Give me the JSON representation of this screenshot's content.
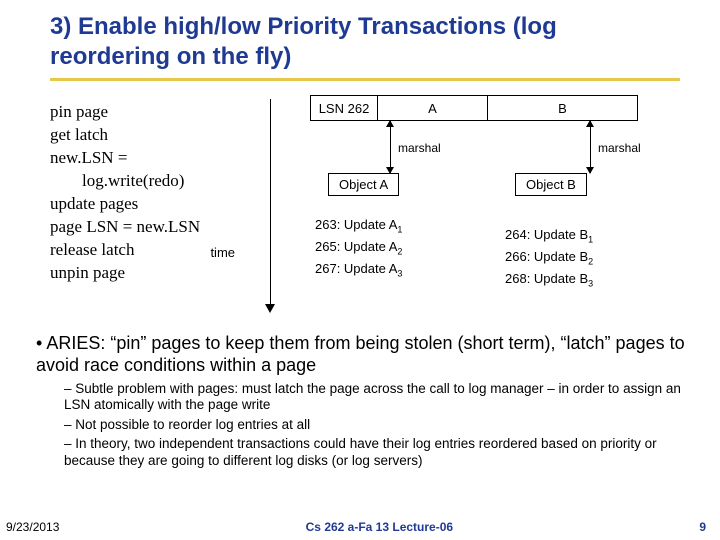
{
  "title": "3) Enable high/low Priority Transactions (log reordering on the fly)",
  "code": {
    "l1": "pin page",
    "l2": "get latch",
    "l3": "new.LSN =",
    "l4": "log.write(redo)",
    "l5": "update pages",
    "l6": "page LSN = new.LSN",
    "l7": "release latch",
    "l8": "unpin page"
  },
  "time_label": "time",
  "lsn_row": {
    "lsn": "LSN 262",
    "a": "A",
    "b": "B"
  },
  "objects": {
    "a": "Object A",
    "b": "Object B"
  },
  "marshal_label": "marshal",
  "updates_a": [
    "263: Update A",
    "265: Update A",
    "267: Update A"
  ],
  "updates_a_sub": [
    "1",
    "2",
    "3"
  ],
  "updates_b": [
    "264: Update B",
    "266: Update B",
    "268: Update B"
  ],
  "updates_b_sub": [
    "1",
    "2",
    "3"
  ],
  "bullets": {
    "main": "ARIES: “pin” pages to keep them from being stolen (short term), “latch” pages to avoid race conditions within a page",
    "sub1": "Subtle problem with pages: must latch the page across the call to log manager – in order to assign an LSN atomically with the page write",
    "sub2": "Not possible to reorder log entries at all",
    "sub3": "In theory, two independent transactions could have their log entries reordered based on priority or because they are going to different log disks (or log servers)"
  },
  "footer": {
    "left": "9/23/2013",
    "center": "Cs 262 a-Fa 13 Lecture-06",
    "right": "9"
  }
}
